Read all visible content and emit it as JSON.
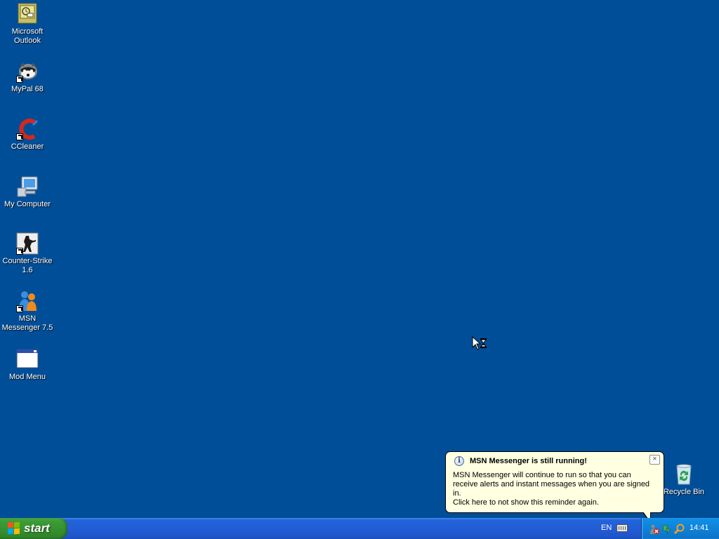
{
  "desktop": {
    "icons": [
      {
        "label": "Microsoft Outlook",
        "icon": "outlook-icon"
      },
      {
        "label": "MyPal 68",
        "icon": "mypal-icon"
      },
      {
        "label": "CCleaner",
        "icon": "ccleaner-icon"
      },
      {
        "label": "My Computer",
        "icon": "my-computer-icon"
      },
      {
        "label": "Counter-Strike 1.6",
        "icon": "counter-strike-icon"
      },
      {
        "label": "MSN Messenger 7.5",
        "icon": "msn-messenger-icon"
      },
      {
        "label": "Mod Menu",
        "icon": "window-icon"
      }
    ],
    "recycle_bin": {
      "label": "Recycle Bin",
      "icon": "recycle-bin-icon"
    }
  },
  "taskbar": {
    "start_label": "start",
    "language": "EN",
    "clock": "14:41"
  },
  "balloon": {
    "title": "MSN Messenger is still running!",
    "body": "MSN Messenger will continue to run so that you can receive alerts and instant messages when you are signed in.",
    "link": "Click here to not show this reminder again.",
    "close": "×"
  },
  "colors": {
    "desktop_background": "#004e98",
    "taskbar_blue": "#225dd6",
    "start_green": "#3c9c37",
    "balloon_background": "#ffffe1"
  }
}
